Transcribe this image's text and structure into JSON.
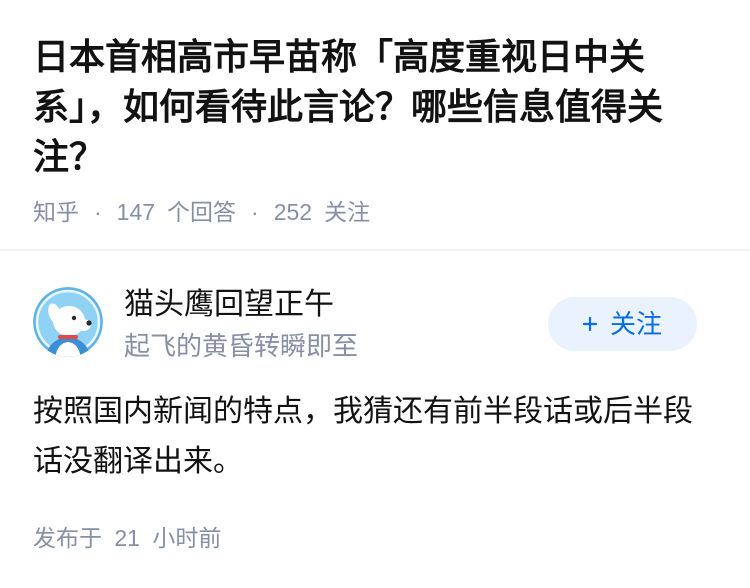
{
  "question": {
    "title": "日本首相高市早苗称「高度重视日中关系」，如何看待此言论？哪些信息值得关注？",
    "source": "知乎",
    "separator": "·",
    "answer_count": "147",
    "answer_label": "个回答",
    "follower_count": "252",
    "follower_label": "关注"
  },
  "answer": {
    "author": {
      "name": "猫头鹰回望正午",
      "headline": "起飞的黄昏转瞬即至",
      "avatar_icon": "dog-avatar-icon"
    },
    "follow_button": {
      "icon": "plus-icon",
      "label": "关注"
    },
    "content": "按照国内新闻的特点，我猜还有前半段话或后半段话没翻译出来。",
    "published": "发布于 21 小时前"
  },
  "colors": {
    "text_primary": "#121212",
    "text_secondary": "#8590a6",
    "accent": "#056de8",
    "follow_bg": "#eaf3fd",
    "divider": "#f0f2f5"
  }
}
